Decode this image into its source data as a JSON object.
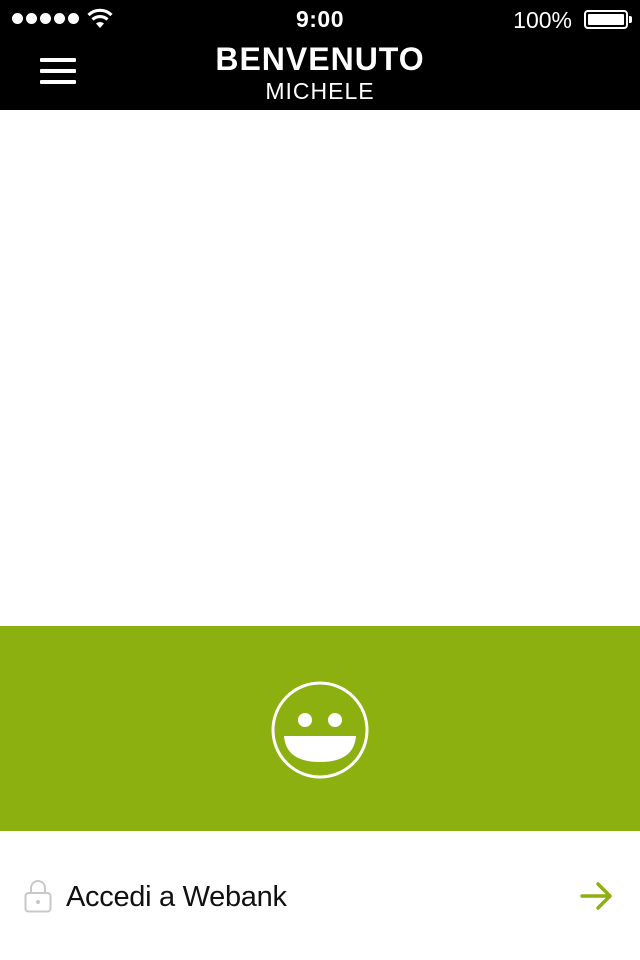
{
  "status_bar": {
    "time": "9:00",
    "battery_percent": "100%",
    "signal_icon": "signal-dots-icon",
    "wifi_icon": "wifi-icon",
    "battery_icon": "battery-icon"
  },
  "header": {
    "title": "BENVENUTO",
    "subtitle": "MICHELE",
    "menu_icon": "hamburger-menu-icon"
  },
  "banner": {
    "icon": "smiley-face-icon",
    "color": "#8bb00f"
  },
  "login": {
    "label": "Accedi a Webank",
    "lock_icon": "lock-icon",
    "arrow_icon": "arrow-right-icon",
    "arrow_color": "#8bb00f"
  }
}
